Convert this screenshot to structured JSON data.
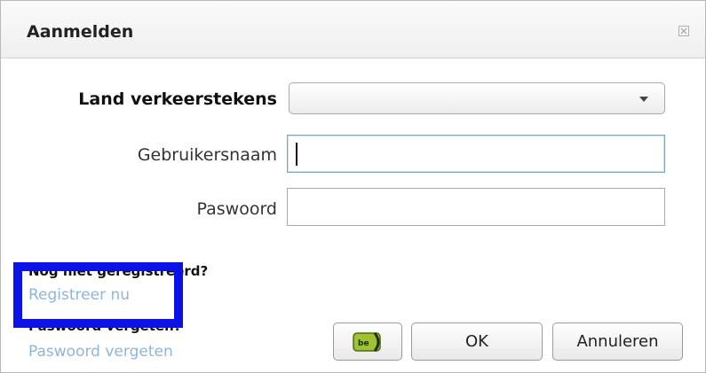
{
  "dialog": {
    "title": "Aanmelden",
    "close_icon": "close-icon"
  },
  "form": {
    "country_label": "Land verkeerstekens",
    "country_value": "",
    "username_label": "Gebruikersnaam",
    "username_value": "",
    "password_label": "Paswoord",
    "password_value": ""
  },
  "footer": {
    "not_registered_text": "Nog niet geregistreerd?",
    "register_link": "Registreer nu",
    "forgot_text": "Paswoord vergeten?",
    "forgot_link": "Paswoord vergeten"
  },
  "buttons": {
    "beid_icon": "belgian-eid-card-icon",
    "beid_text": "be",
    "ok_label": "OK",
    "cancel_label": "Annuleren"
  },
  "colors": {
    "link": "#8fb5d8",
    "highlight": "#0b12e6"
  }
}
